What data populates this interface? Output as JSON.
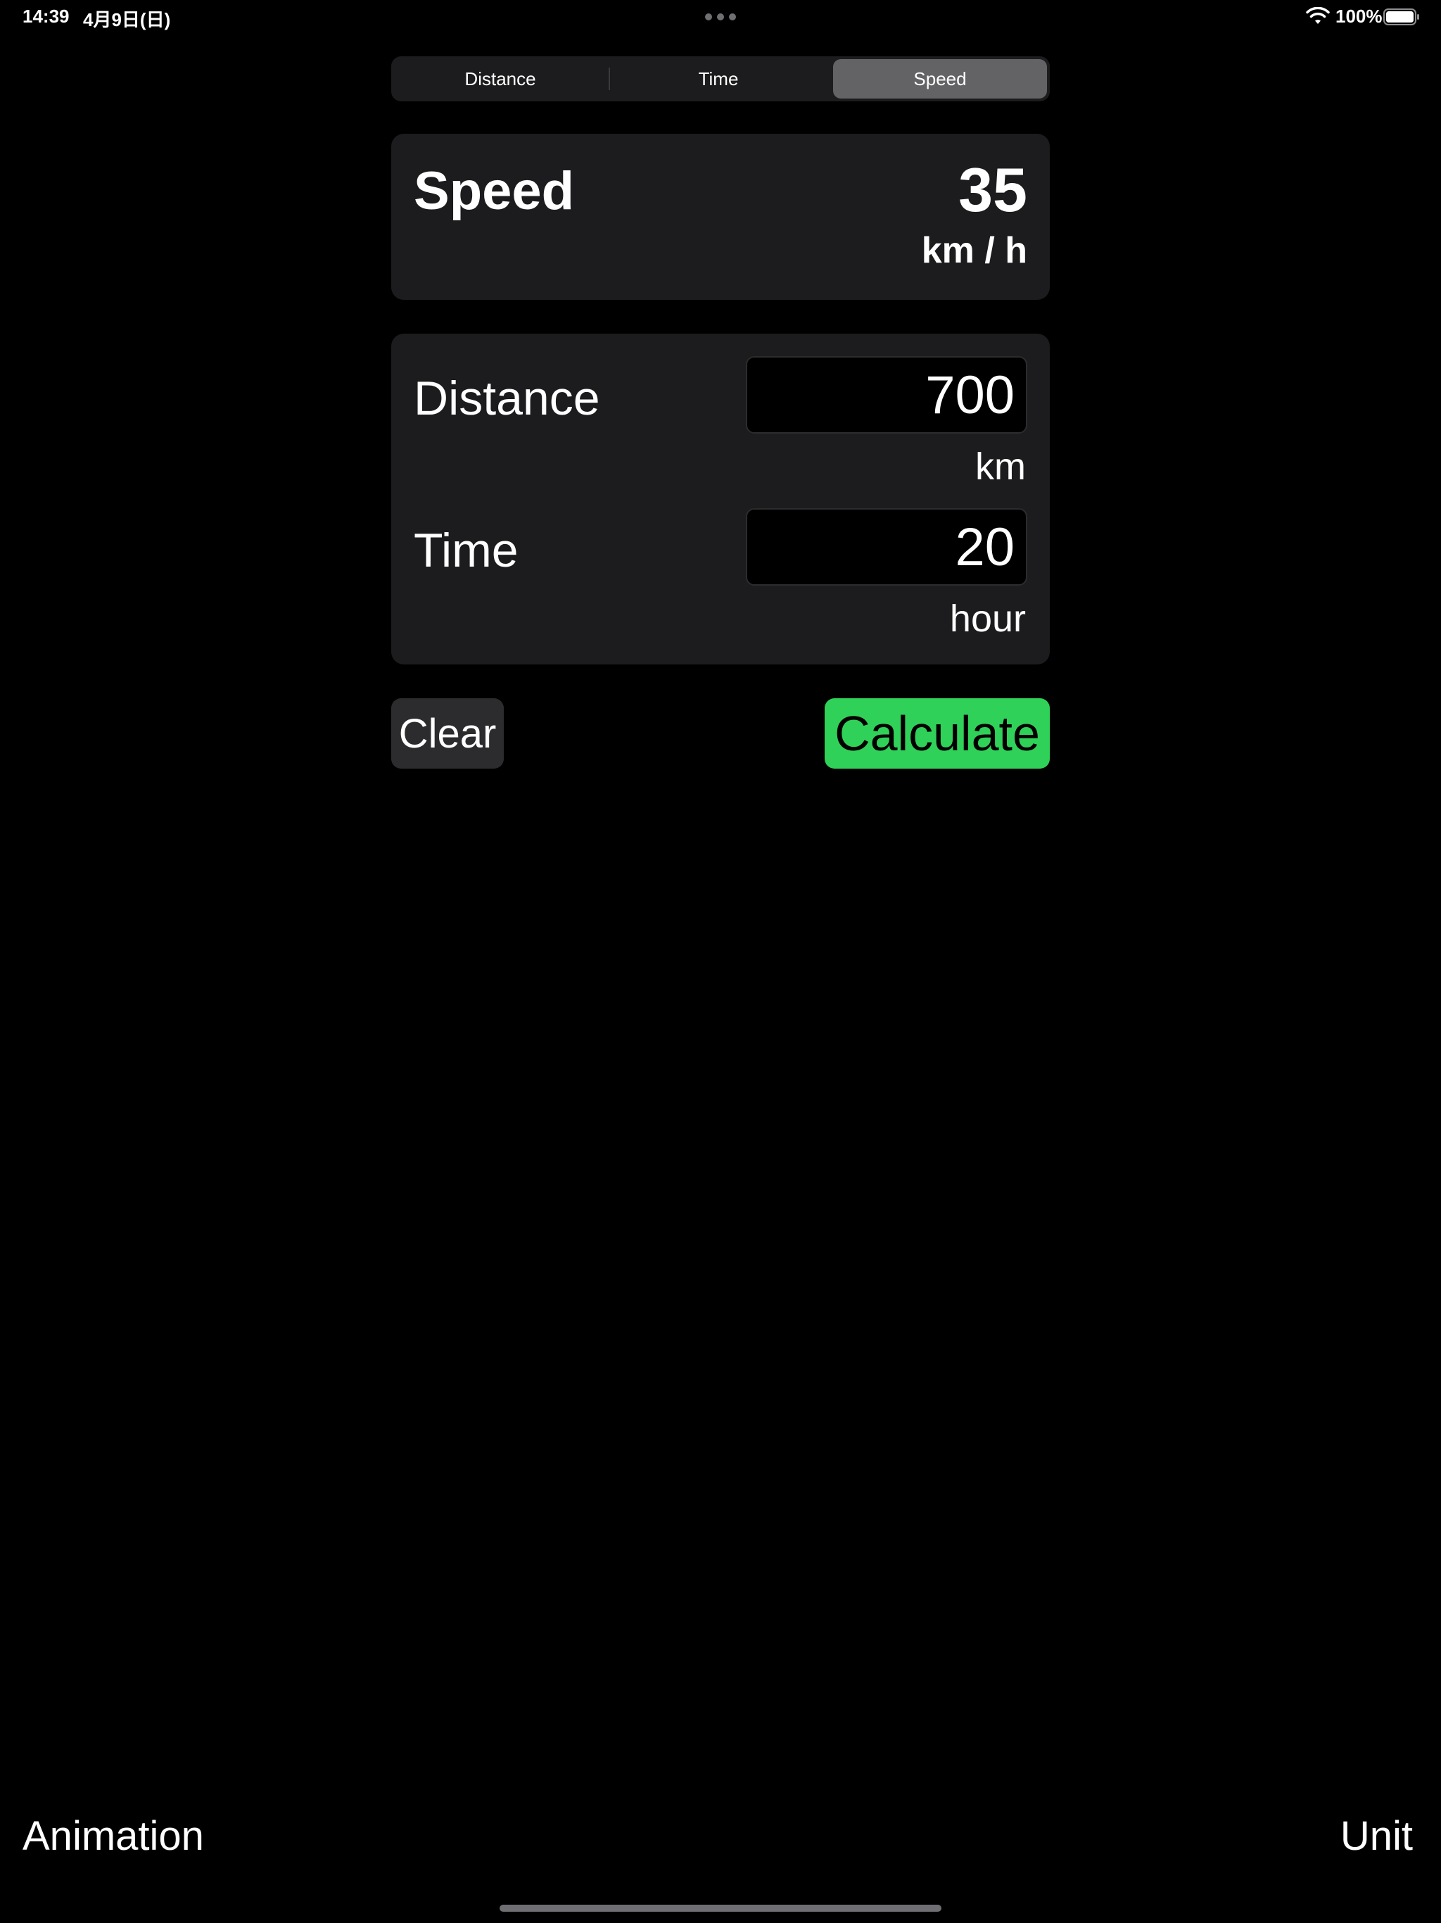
{
  "status_bar": {
    "time": "14:39",
    "date": "4月9日(日)",
    "battery": "100%"
  },
  "segmented": {
    "selected": "Speed",
    "segments": [
      "Distance",
      "Time",
      "Speed"
    ]
  },
  "result": {
    "label": "Speed",
    "value": "35",
    "unit": "km / h"
  },
  "inputs": {
    "distance": {
      "label": "Distance",
      "value": "700",
      "unit": "km"
    },
    "time": {
      "label": "Time",
      "value": "20",
      "unit": "hour"
    }
  },
  "buttons": {
    "clear": "Clear",
    "calculate": "Calculate"
  },
  "toolbar": {
    "left": "Animation",
    "right": "Unit"
  },
  "colors": {
    "background": "#000000",
    "card": "#1c1c1e",
    "selected_segment": "#636366",
    "calculate": "#30d158"
  },
  "icons": {
    "wifi": "wifi-icon",
    "battery": "battery-icon",
    "multitasking": "multitasking-dots-icon"
  }
}
